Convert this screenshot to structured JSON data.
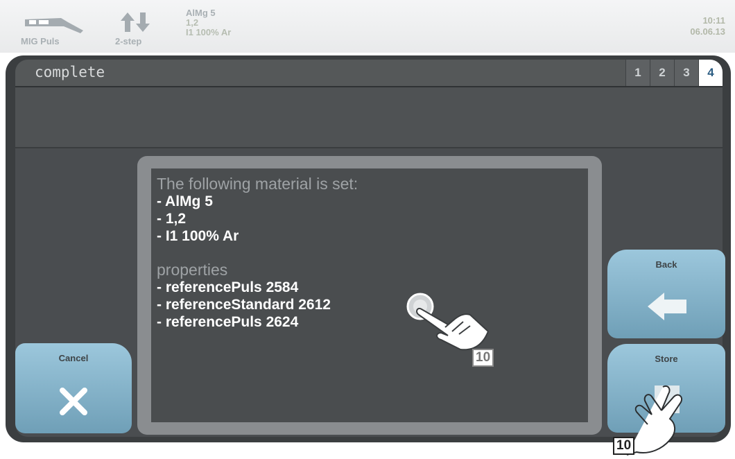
{
  "status": {
    "process_label": "MIG Puls",
    "mode_label": "2-step",
    "material": "AlMg 5",
    "diameter": "1,2",
    "gas": "I1 100% Ar",
    "time": "10:11",
    "date": "06.06.13"
  },
  "header": {
    "title": "complete",
    "pages": [
      "1",
      "2",
      "3",
      "4"
    ],
    "active_page": "4"
  },
  "dialog": {
    "heading": "The following material is set:",
    "material_lines": [
      "- AlMg 5",
      "- 1,2",
      "- I1 100% Ar"
    ],
    "properties_heading": "properties",
    "property_lines": [
      "- referencePuls 2584",
      "- referenceStandard 2612",
      "- referencePuls 2624"
    ]
  },
  "buttons": {
    "cancel": "Cancel",
    "back": "Back",
    "store": "Store"
  },
  "callouts": {
    "dialog_step": "10",
    "store_step": "10"
  },
  "colors": {
    "button_top": "#9cc7dc",
    "button_bottom": "#6f9fb7",
    "frame": "#3b3e40",
    "active_page": "#ffffff"
  },
  "icons": [
    "torch-icon",
    "up-down-arrows-icon",
    "left-arrow-icon",
    "x-icon",
    "save-icon",
    "hand-pointer-icon"
  ]
}
